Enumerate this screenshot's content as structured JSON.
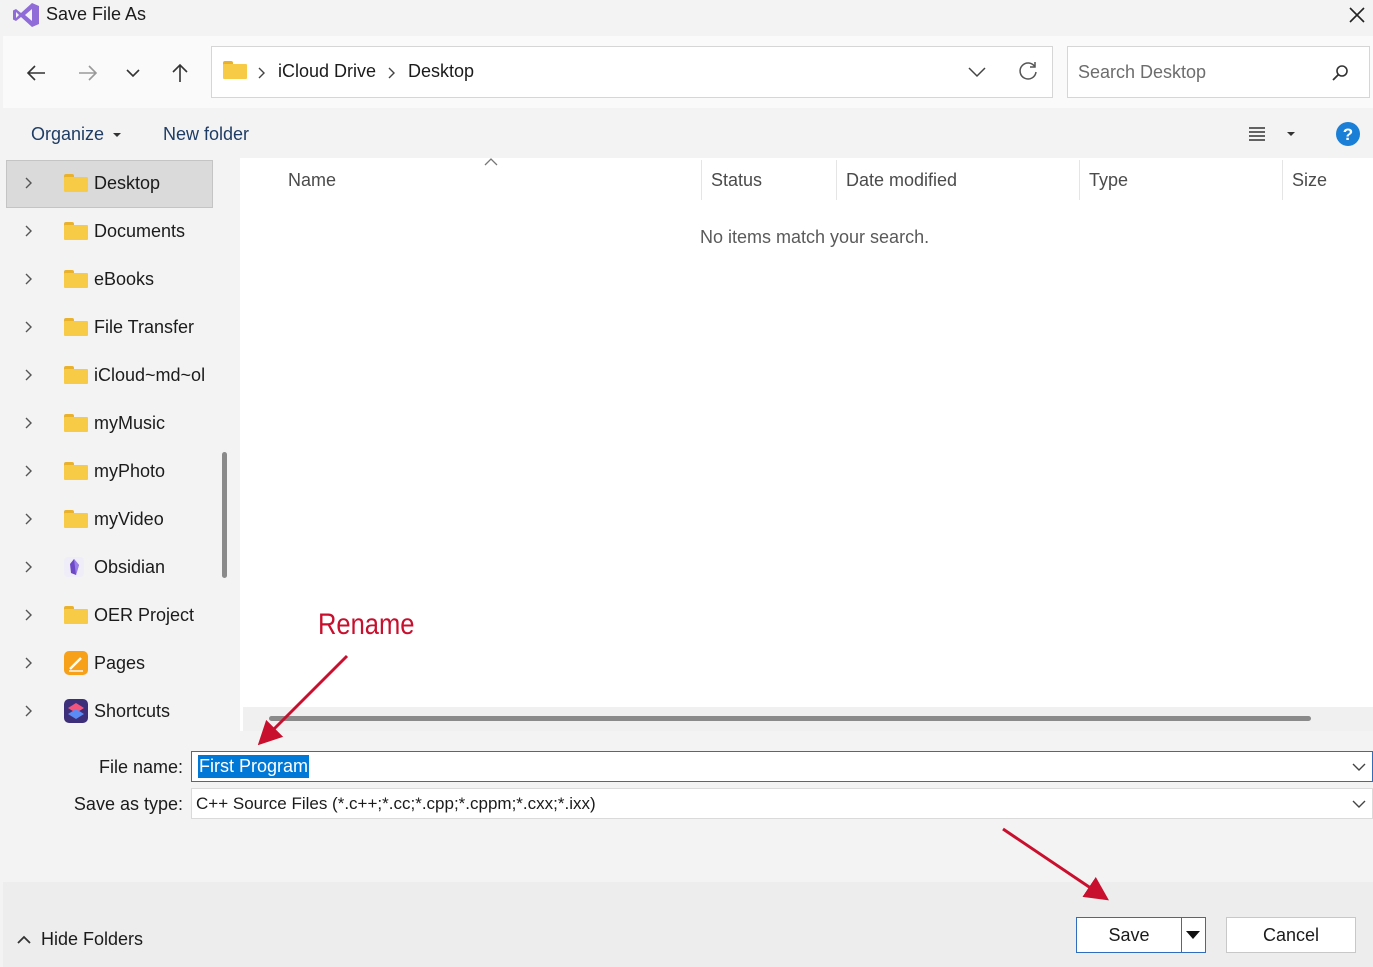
{
  "window": {
    "title": "Save File As"
  },
  "nav_buttons": {
    "back": "back-arrow-icon",
    "forward": "forward-arrow-icon",
    "recent": "chevron-down-icon",
    "up": "up-arrow-icon"
  },
  "address": {
    "crumbs": [
      "iCloud Drive",
      "Desktop"
    ]
  },
  "search": {
    "placeholder": "Search Desktop"
  },
  "toolbar": {
    "organize": "Organize",
    "new_folder": "New folder"
  },
  "sidebar": {
    "items": [
      {
        "label": "Desktop",
        "icon": "folder-icon",
        "selected": true
      },
      {
        "label": "Documents",
        "icon": "folder-icon"
      },
      {
        "label": "eBooks",
        "icon": "folder-icon"
      },
      {
        "label": "File Transfer",
        "icon": "folder-icon"
      },
      {
        "label": "iCloud~md~ol",
        "icon": "folder-icon"
      },
      {
        "label": "myMusic",
        "icon": "folder-icon"
      },
      {
        "label": "myPhoto",
        "icon": "folder-icon"
      },
      {
        "label": "myVideo",
        "icon": "folder-icon"
      },
      {
        "label": "Obsidian",
        "icon": "obsidian-icon"
      },
      {
        "label": "OER Project",
        "icon": "folder-icon"
      },
      {
        "label": "Pages",
        "icon": "pages-icon"
      },
      {
        "label": "Shortcuts",
        "icon": "shortcuts-icon"
      }
    ]
  },
  "columns": [
    "Name",
    "Status",
    "Date modified",
    "Type",
    "Size"
  ],
  "empty_message": "No items match your search.",
  "fields": {
    "file_name_label": "File name:",
    "file_name_value": "First Program",
    "save_type_label": "Save as type:",
    "save_type_value": "C++ Source Files (*.c++;*.cc;*.cpp;*.cppm;*.cxx;*.ixx)"
  },
  "footer": {
    "hide_folders": "Hide Folders",
    "save": "Save",
    "cancel": "Cancel"
  },
  "annotation": {
    "text": "Rename",
    "color": "#c8102e"
  },
  "colors": {
    "accent": "#0067c0",
    "selection": "#0078d7",
    "sidebar_selected": "#dadada"
  }
}
